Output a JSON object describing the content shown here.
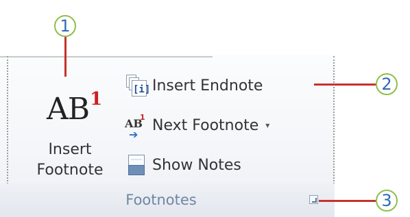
{
  "ribbon_group": {
    "label": "Footnotes",
    "insert_footnote": {
      "icon_text": "AB",
      "icon_superscript": "1",
      "label_line1": "Insert",
      "label_line2": "Footnote"
    },
    "insert_endnote": {
      "label": "Insert Endnote",
      "icon_text": "[i]"
    },
    "next_footnote": {
      "label": "Next Footnote",
      "icon_text": "AB",
      "icon_superscript": "1",
      "dropdown": "▾"
    },
    "show_notes": {
      "label": "Show Notes"
    }
  },
  "callouts": [
    "1",
    "2",
    "3"
  ],
  "colors": {
    "callout_border": "#8dbf4a",
    "callout_text": "#2f6ab0",
    "callout_line": "#c5322c",
    "group_label": "#6f86a1"
  }
}
